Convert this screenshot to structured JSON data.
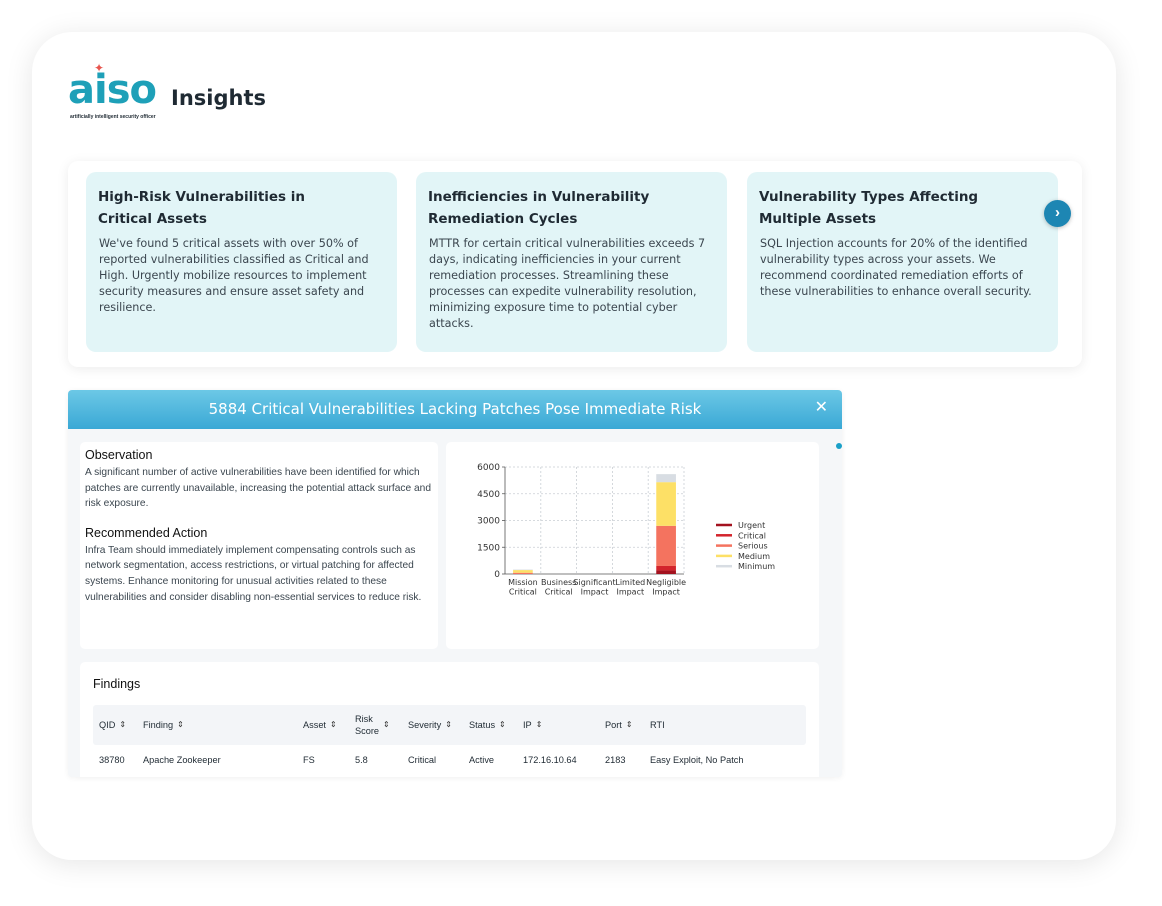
{
  "brand": {
    "logo_text": "aiso",
    "tagline": "artificially intelligent security officer"
  },
  "page": {
    "title": "Insights"
  },
  "insights": [
    {
      "title": "High-Risk Vulnerabilities in\nCritical Assets",
      "body": "We've found 5 critical assets with over 50% of reported vulnerabilities classified as Critical and High. Urgently mobilize resources to implement security measures and ensure asset safety and resilience."
    },
    {
      "title": "Inefficiencies in Vulnerability\nRemediation Cycles",
      "body": "MTTR for certain critical vulnerabilities exceeds 7 days, indicating inefficiencies in your current remediation processes. Streamlining these processes can expedite vulnerability resolution, minimizing exposure time to potential cyber attacks."
    },
    {
      "title": "Vulnerability Types Affecting\nMultiple Assets",
      "body": "SQL Injection accounts for 20% of the identified vulnerability types across your assets. We recommend coordinated remediation efforts of these vulnerabilities to enhance overall security."
    }
  ],
  "next_icon": "chevron-right-icon",
  "detail": {
    "title": "5884 Critical Vulnerabilities Lacking Patches Pose Immediate Risk",
    "close_icon": "close-icon",
    "observation_heading": "Observation",
    "observation_text": "A significant number of active vulnerabilities have been identified for which patches are currently unavailable, increasing the potential attack surface and risk exposure.",
    "action_heading": "Recommended Action",
    "action_text": "Infra Team should immediately implement compensating controls such as network segmentation, access restrictions, or virtual patching for affected systems. Enhance monitoring for unusual activities related to these vulnerabilities and consider disabling non-essential services to reduce risk."
  },
  "chart_data": {
    "type": "bar",
    "stacked": true,
    "categories": [
      "Mission Critical",
      "Business Critical",
      "Significant Impact",
      "Limited Impact",
      "Negligible Impact"
    ],
    "category_lines": [
      [
        "Mission",
        "Critical"
      ],
      [
        "Business",
        "Critical"
      ],
      [
        "Significant",
        "Impact"
      ],
      [
        "Limited",
        "Impact"
      ],
      [
        "Negligible",
        "Impact"
      ]
    ],
    "series": [
      {
        "name": "Urgent",
        "color": "#a3121f",
        "values": [
          0,
          0,
          0,
          0,
          200
        ]
      },
      {
        "name": "Critical",
        "color": "#d3242c",
        "values": [
          0,
          0,
          0,
          0,
          250
        ]
      },
      {
        "name": "Serious",
        "color": "#f4735f",
        "values": [
          70,
          0,
          0,
          0,
          2250
        ]
      },
      {
        "name": "Medium",
        "color": "#fde066",
        "values": [
          150,
          0,
          0,
          0,
          2450
        ]
      },
      {
        "name": "Minimum",
        "color": "#d8dde3",
        "values": [
          30,
          0,
          0,
          0,
          450
        ]
      }
    ],
    "ylim": [
      0,
      6000
    ],
    "yticks": [
      0,
      1500,
      3000,
      4500,
      6000
    ],
    "grid": true,
    "legend": "right"
  },
  "findings": {
    "title": "Findings",
    "sort_icon": "sort-icon",
    "columns": [
      "QID",
      "Finding",
      "Asset",
      "Risk\nScore",
      "Severity",
      "Status",
      "IP",
      "Port",
      "RTI"
    ],
    "rows": [
      [
        "38780",
        "Apache Zookeeper",
        "FS",
        "5.8",
        "Critical",
        "Active",
        "172.16.10.64",
        "2183",
        "Easy Exploit, No Patch"
      ]
    ]
  }
}
